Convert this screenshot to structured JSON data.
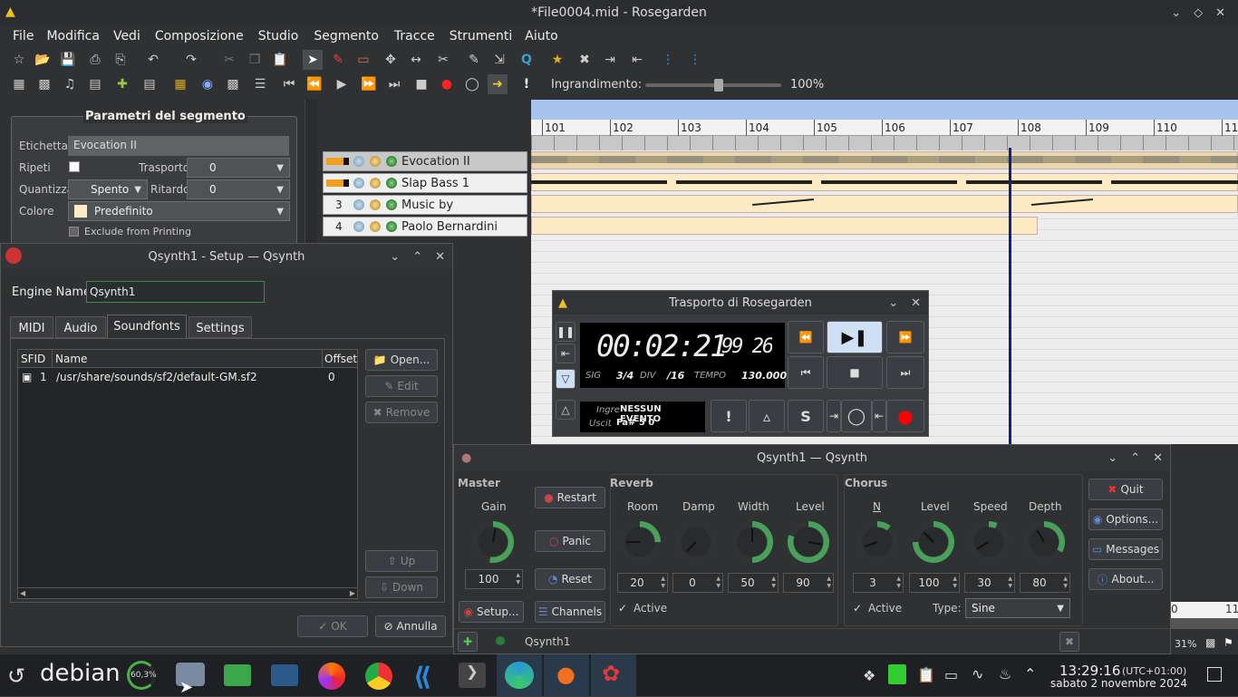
{
  "app": {
    "title": "*File0004.mid - Rosegarden",
    "menu": [
      "File",
      "Modifica",
      "Vedi",
      "Composizione",
      "Studio",
      "Segmento",
      "Tracce",
      "Strumenti",
      "Aiuto"
    ],
    "zoom_label": "Ingrandimento:",
    "zoom_value": "100%",
    "zoom_fraction": 0.5
  },
  "segment_params": {
    "title": "Parametri del segmento",
    "label_label": "Etichetta",
    "label_value": "Evocation II",
    "repeat_label": "Ripeti",
    "transpose_label": "Trasporto",
    "transpose_value": "0",
    "quantize_label": "Quantizza",
    "quantize_value": "Spento",
    "delay_label": "Ritardo",
    "delay_value": "0",
    "color_label": "Colore",
    "color_value": "Predefinito",
    "exclude_label": "Exclude from Printing"
  },
  "ruler": [
    "101",
    "102",
    "103",
    "104",
    "105",
    "106",
    "107",
    "108",
    "109",
    "110",
    "11"
  ],
  "tracks": [
    {
      "num": "",
      "name": "Evocation II"
    },
    {
      "num": "",
      "name": "Slap Bass 1"
    },
    {
      "num": "3",
      "name": "Music by"
    },
    {
      "num": "4",
      "name": "Paolo Bernardini"
    }
  ],
  "transport": {
    "title": "Trasporto di Rosegarden",
    "time": "00:02:21",
    "frames": "99 26",
    "sig_label": "SIG",
    "sig": "3/4",
    "div_label": "DIV",
    "div": "/16",
    "tempo_label": "TEMPO",
    "tempo": "130.000",
    "in_label": "Ingre",
    "in_value": "NESSUN EVENTO",
    "out_label": "Uscita",
    "out_value": "Fa# 5  0",
    "solo_label": "S",
    "bang_label": "!"
  },
  "qsynth_setup": {
    "title": "Qsynth1 - Setup — Qsynth",
    "engine_label": "Engine Name:",
    "engine_value": "Qsynth1",
    "tabs": [
      "MIDI",
      "Audio",
      "Soundfonts",
      "Settings"
    ],
    "cols": [
      "SFID",
      "Name",
      "Offset"
    ],
    "rows": [
      {
        "sfid": "1",
        "name": "/usr/share/sounds/sf2/default-GM.sf2",
        "offset": "0"
      }
    ],
    "open": "Open...",
    "edit": "Edit",
    "remove": "Remove",
    "up": "Up",
    "down": "Down",
    "ok": "OK",
    "cancel": "Annulla"
  },
  "qsynth_main": {
    "title": "Qsynth1 — Qsynth",
    "master": "Master",
    "gain": "Gain",
    "gain_value": "100",
    "restart": "Restart",
    "panic": "Panic",
    "reset": "Reset",
    "setup": "Setup...",
    "channels": "Channels",
    "reverb": "Reverb",
    "reverb_labels": [
      "Room",
      "Damp",
      "Width",
      "Level"
    ],
    "reverb_values": [
      "20",
      "0",
      "50",
      "90"
    ],
    "chorus": "Chorus",
    "chorus_labels": [
      "N",
      "Level",
      "Speed",
      "Depth"
    ],
    "chorus_values": [
      "3",
      "100",
      "30",
      "80"
    ],
    "active": "Active",
    "type_label": "Type:",
    "type_value": "Sine",
    "quit": "Quit",
    "options": "Options...",
    "messages": "Messages",
    "about": "About...",
    "engine_tab": "Qsynth1"
  },
  "right_edge": {
    "ruler_partial": "0",
    "ruler_partial2": "11",
    "pct": "31%"
  },
  "taskbar": {
    "os": "debian",
    "cpu": "60,3%",
    "time": "13:29:16",
    "tz": "(UTC+01:00)",
    "date": "sabato 2 novembre 2024"
  }
}
